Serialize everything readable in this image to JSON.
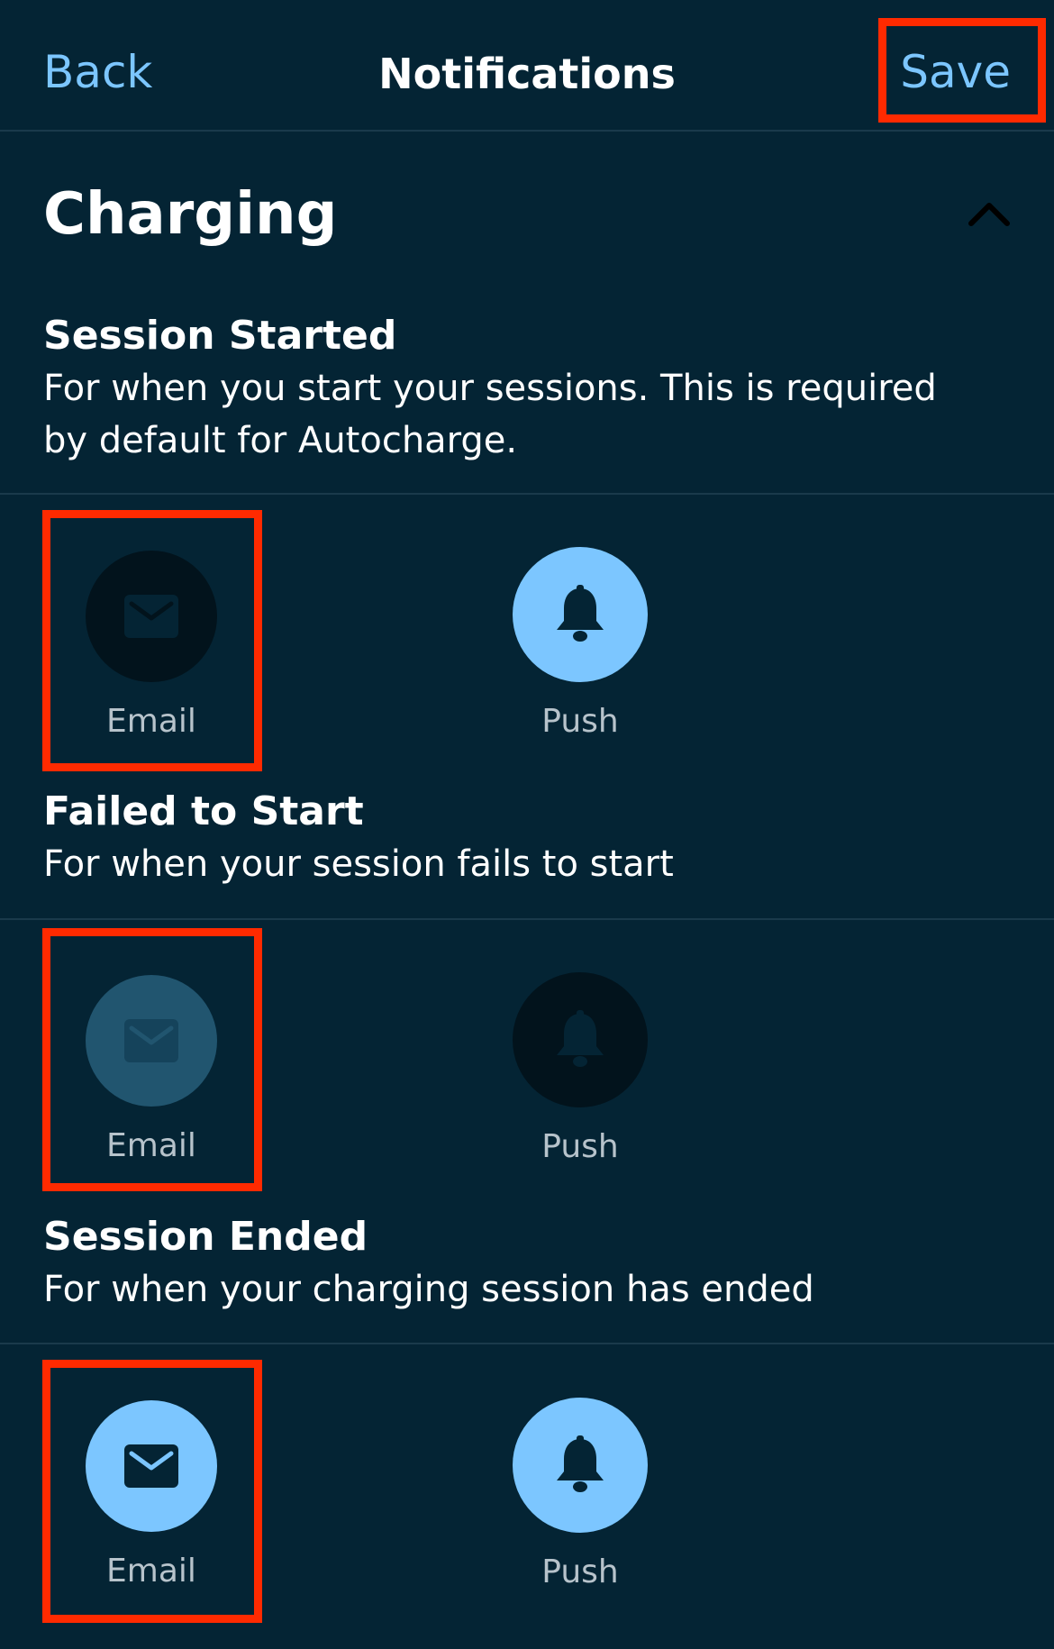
{
  "nav": {
    "back_label": "Back",
    "title": "Notifications",
    "save_label": "Save"
  },
  "section": {
    "title": "Charging",
    "expanded": true
  },
  "notifications": [
    {
      "title": "Session Started",
      "description_line1": "For when you start your sessions. This is required",
      "description_line2": "by default for Autocharge.",
      "email": {
        "label": "Email",
        "state": "dark"
      },
      "push": {
        "label": "Push",
        "state": "active"
      }
    },
    {
      "title": "Failed to Start",
      "description_line1": "For when your session fails to start",
      "email": {
        "label": "Email",
        "state": "muted"
      },
      "push": {
        "label": "Push",
        "state": "dark"
      }
    },
    {
      "title": "Session Ended",
      "description_line1": "For when your charging session has ended",
      "email": {
        "label": "Email",
        "state": "active"
      },
      "push": {
        "label": "Push",
        "state": "active"
      }
    }
  ],
  "colors": {
    "background": "#042434",
    "accent": "#7cc6ff",
    "highlight": "#ff2a00",
    "divider": "#1a3a4b",
    "option_dark": "#02131c",
    "option_muted": "#21556f",
    "label_gray": "#b7c3cb"
  }
}
